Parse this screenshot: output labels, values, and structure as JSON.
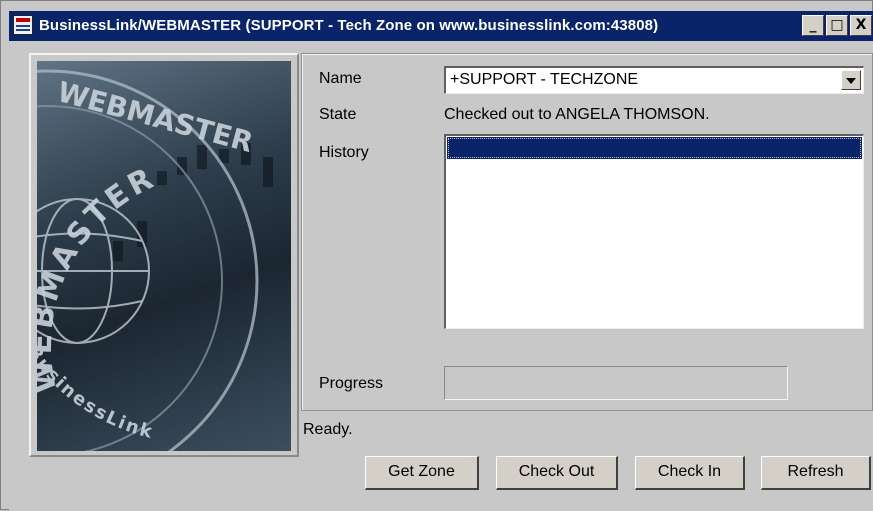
{
  "window": {
    "title": "BusinessLink/WEBMASTER (SUPPORT - Tech Zone on www.businesslink.com:43808)",
    "minimize_label": "_",
    "maximize_label": "□",
    "close_label": "X"
  },
  "logo": {
    "brand_text": "BusinessLink",
    "seal_text": "WEBMASTER",
    "seal_text_repeat": "WEBMASTER"
  },
  "form": {
    "name_label": "Name",
    "name_value": "+SUPPORT - TECHZONE",
    "state_label": "State",
    "state_value": "Checked out to ANGELA THOMSON.",
    "history_label": "History",
    "progress_label": "Progress",
    "progress_fraction": 0
  },
  "status": {
    "text": "Ready."
  },
  "buttons": {
    "get_zone": "Get Zone",
    "check_out": "Check Out",
    "check_in": "Check In",
    "refresh": "Refresh"
  }
}
